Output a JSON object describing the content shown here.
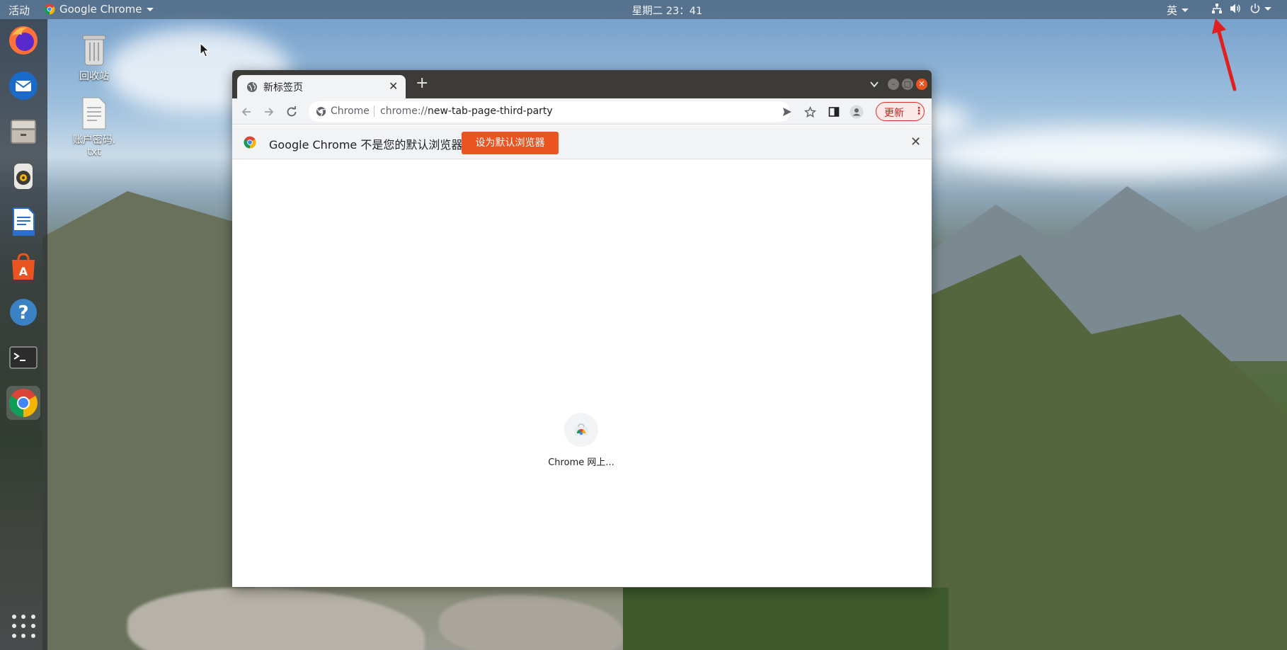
{
  "topbar": {
    "activities": "活动",
    "app_menu": "Google Chrome",
    "clock": "星期二 23：41",
    "input_method": "英"
  },
  "dock": {
    "items": [
      {
        "name": "Firefox",
        "icon": "firefox-icon"
      },
      {
        "name": "Thunderbird",
        "icon": "thunderbird-icon"
      },
      {
        "name": "Files",
        "icon": "files-icon"
      },
      {
        "name": "Rhythmbox",
        "icon": "rhythmbox-icon"
      },
      {
        "name": "LibreOffice Writer",
        "icon": "writer-icon"
      },
      {
        "name": "Ubuntu Software",
        "icon": "software-icon"
      },
      {
        "name": "Help",
        "icon": "help-icon"
      },
      {
        "name": "Terminal",
        "icon": "terminal-icon"
      },
      {
        "name": "Google Chrome",
        "icon": "chrome-icon"
      }
    ]
  },
  "desktop": {
    "trash_label": "回收站",
    "file_label_line1": "账户密码.",
    "file_label_line2": "txt"
  },
  "chrome": {
    "tab_title": "新标签页",
    "omnibox_site": "Chrome",
    "omnibox_url_prefix": "chrome://",
    "omnibox_url_host": "new-tab-page-third-party",
    "update_label": "更新",
    "infobar_message": "Google Chrome 不是您的默认浏览器",
    "infobar_button": "设为默认浏览器",
    "shortcut_label": "Chrome 网上..."
  },
  "colors": {
    "ubuntu_orange": "#e95420",
    "update_red": "#d93025",
    "titlebar": "#3c3b37"
  }
}
